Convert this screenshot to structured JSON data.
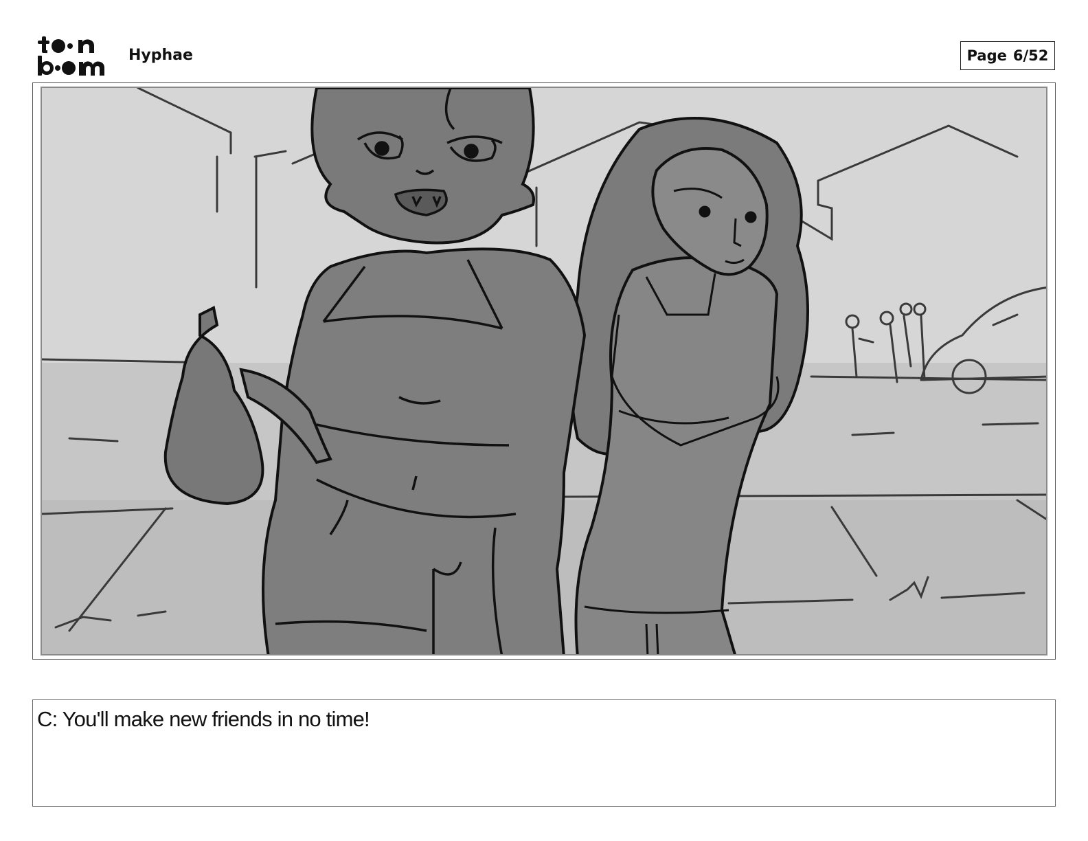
{
  "header": {
    "logo": {
      "line1": "toon",
      "line2": "boom"
    },
    "project_title": "Hyphae",
    "page_label": "Page",
    "page_number": "6/52"
  },
  "panel": {
    "description_icon": "storyboard-sketch"
  },
  "caption": {
    "text": "C: You'll make new friends in no time!"
  }
}
